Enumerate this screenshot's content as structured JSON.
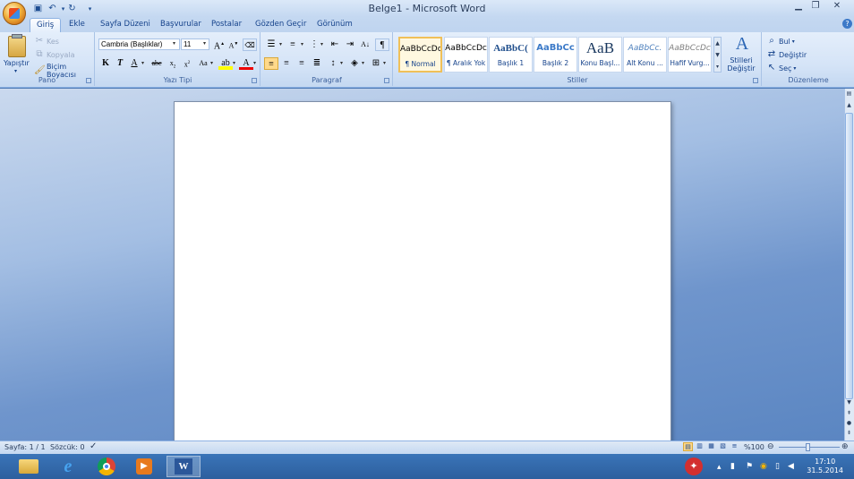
{
  "window": {
    "title": "Belge1 - Microsoft Word"
  },
  "tabs": [
    "Giriş",
    "Ekle",
    "Sayfa Düzeni",
    "Başvurular",
    "Postalar",
    "Gözden Geçir",
    "Görünüm"
  ],
  "pano": {
    "label": "Pano",
    "paste": "Yapıştır",
    "cut": "Kes",
    "copy": "Kopyala",
    "format_painter": "Biçim Boyacısı"
  },
  "font": {
    "label": "Yazı Tipi",
    "name": "Cambria (Başlıklar)",
    "size": "11"
  },
  "paragraph": {
    "label": "Paragraf"
  },
  "styles": {
    "label": "Stiller",
    "items": [
      {
        "preview": "AaBbCcDc",
        "name": "¶ Normal"
      },
      {
        "preview": "AaBbCcDc",
        "name": "¶ Aralık Yok"
      },
      {
        "preview": "AaBbC(",
        "name": "Başlık 1"
      },
      {
        "preview": "AaBbCc",
        "name": "Başlık 2"
      },
      {
        "preview": "AaB",
        "name": "Konu Başl..."
      },
      {
        "preview": "AaBbCc.",
        "name": "Alt Konu ..."
      },
      {
        "preview": "AaBbCcDc",
        "name": "Hafif Vurg..."
      }
    ],
    "change_styles": "Stilleri Değiştir"
  },
  "editing": {
    "label": "Düzenleme",
    "find": "Bul",
    "replace": "Değiştir",
    "select": "Seç"
  },
  "status": {
    "page": "Sayfa: 1 / 1",
    "words": "Sözcük: 0",
    "zoom": "%100"
  },
  "clock": {
    "time": "17:10",
    "date": "31.5.2014"
  }
}
